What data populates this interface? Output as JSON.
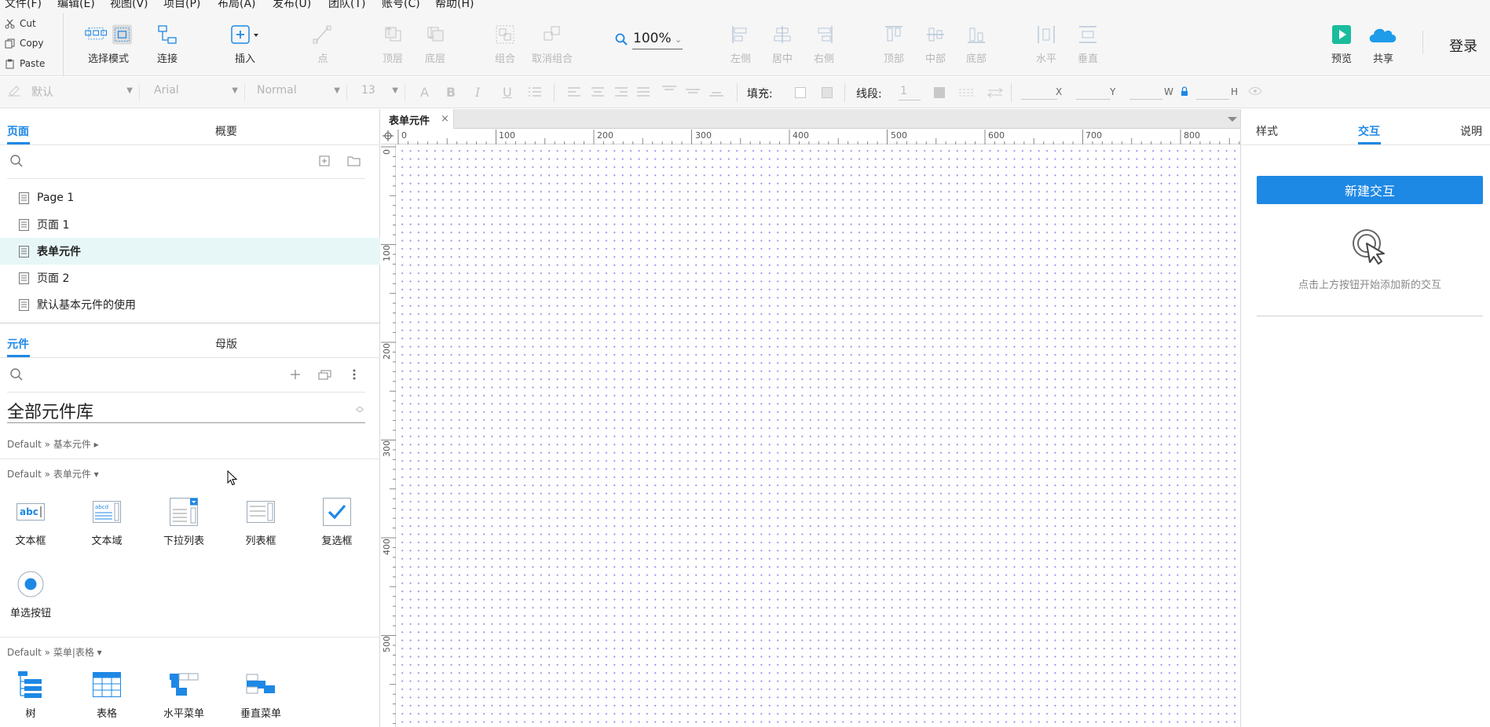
{
  "menubar": {
    "items": [
      "文件(F)",
      "编辑(E)",
      "视图(V)",
      "项目(P)",
      "布局(A)",
      "发布(U)",
      "团队(T)",
      "账号(C)",
      "帮助(H)"
    ]
  },
  "clipboard": {
    "cut": "Cut",
    "copy": "Copy",
    "paste": "Paste"
  },
  "toolbar": {
    "select_mode": "选择模式",
    "connect": "连接",
    "insert": "插入",
    "point": "点",
    "top_layer": "顶层",
    "bottom_layer": "底层",
    "group": "组合",
    "ungroup": "取消组合",
    "zoom": "100%",
    "align_left": "左侧",
    "align_center": "居中",
    "align_right": "右侧",
    "align_top": "顶部",
    "align_middle": "中部",
    "align_bottom": "底部",
    "dist_horizontal": "水平",
    "dist_vertical": "垂直",
    "preview": "预览",
    "share": "共享",
    "login": "登录"
  },
  "formatbar": {
    "style": "默认",
    "font": "Arial",
    "weight": "Normal",
    "size": "13",
    "fill_label": "填充:",
    "stroke_label": "线段:",
    "stroke_value": "1",
    "x_label": "X",
    "y_label": "Y",
    "w_label": "W",
    "h_label": "H"
  },
  "pages_panel": {
    "tab_pages": "页面",
    "tab_outline": "概要",
    "pages": [
      "Page 1",
      "页面 1",
      "表单元件",
      "页面 2",
      "默认基本元件的使用"
    ],
    "active_index": 2
  },
  "library_panel": {
    "tab_widgets": "元件",
    "tab_masters": "母版",
    "library_name": "全部元件库",
    "sections": {
      "basic": "Default » 基本元件 ▸",
      "form": "Default » 表单元件 ▾",
      "menu": "Default » 菜单|表格 ▾"
    },
    "form_widgets": [
      "文本框",
      "文本域",
      "下拉列表",
      "列表框",
      "复选框",
      "单选按钮"
    ],
    "menu_widgets": [
      "树",
      "表格",
      "水平菜单",
      "垂直菜单"
    ],
    "textbox_icon_text": "abc",
    "textarea_icon_text": "abcd"
  },
  "canvas": {
    "tab_title": "表单元件",
    "tab_close": "×",
    "ruler_h": [
      "0",
      "100",
      "200",
      "300",
      "400",
      "500",
      "600",
      "700",
      "800"
    ],
    "ruler_v": [
      "0",
      "100",
      "200",
      "300",
      "400",
      "500"
    ]
  },
  "right_panel": {
    "tab_style": "样式",
    "tab_interaction": "交互",
    "tab_notes": "说明",
    "new_interaction": "新建交互",
    "hint": "点击上方按钮开始添加新的交互"
  },
  "colors": {
    "accent": "#1e88e5",
    "preview_green": "#1abc9c",
    "share_blue": "#1e9be9",
    "grid_dot": "#8e8ef0",
    "active_page_bg": "#e7f7f7"
  }
}
